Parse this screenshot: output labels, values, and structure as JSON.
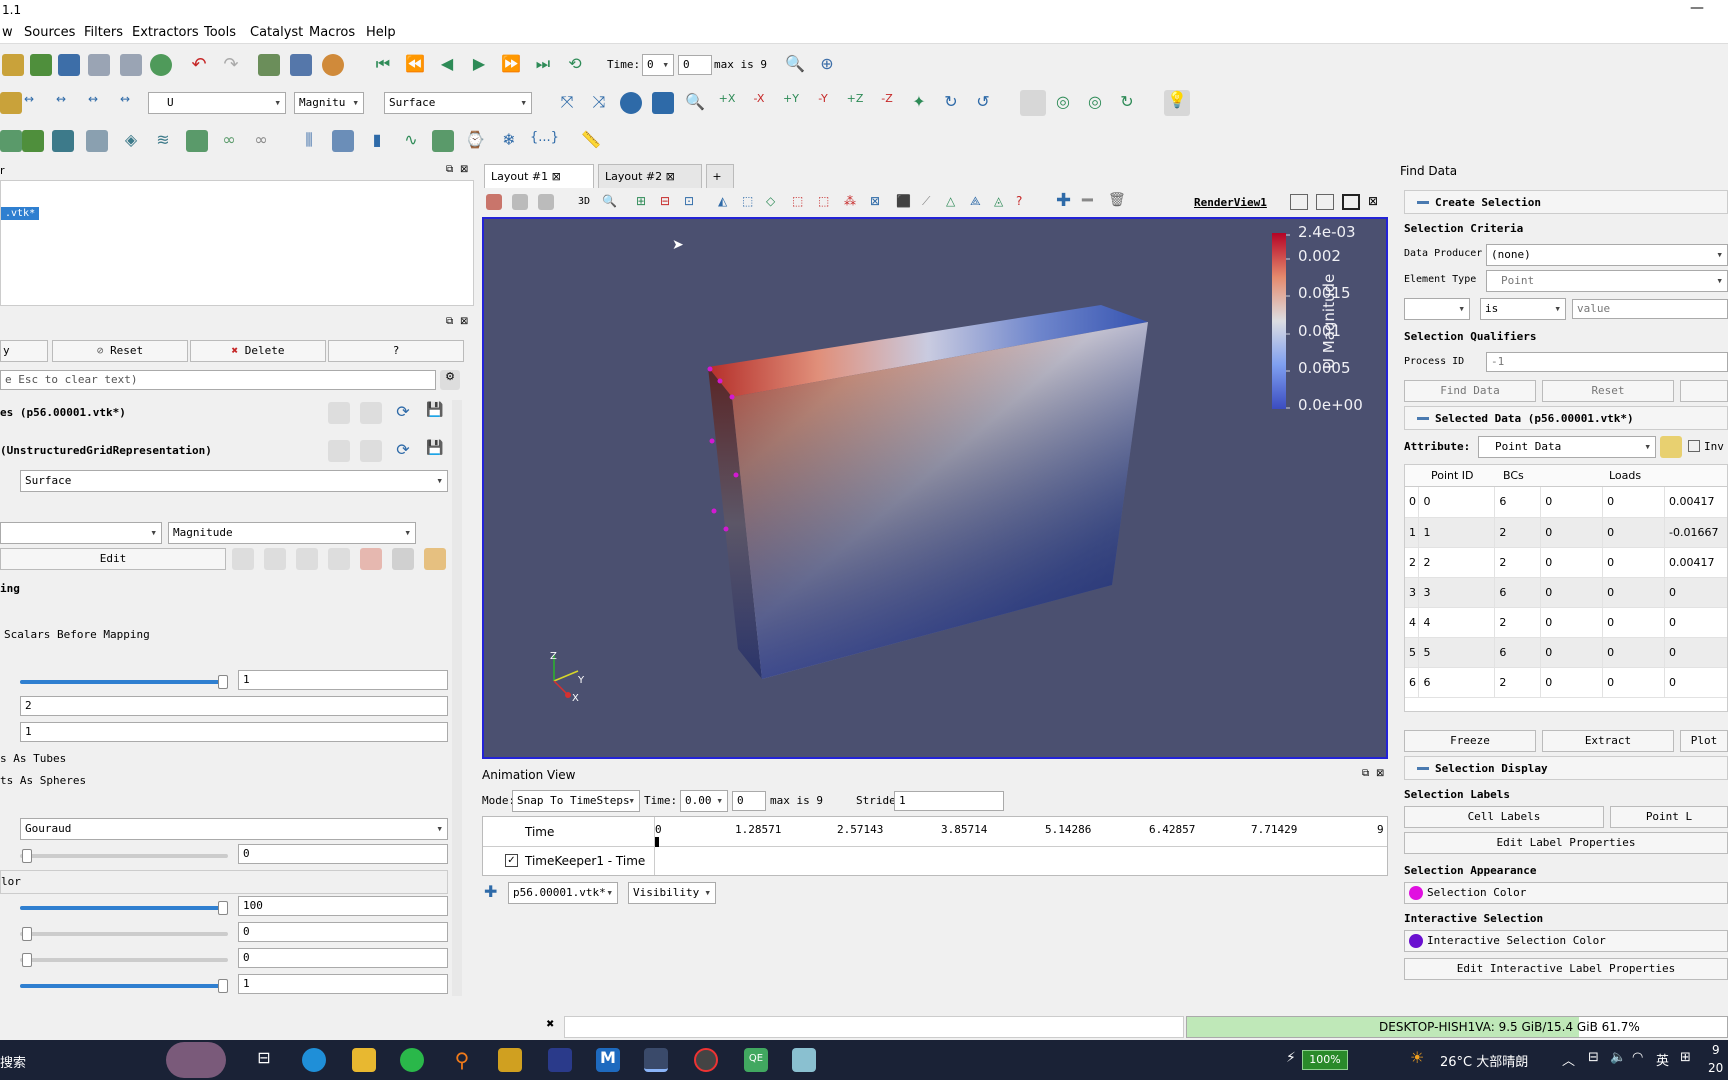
{
  "window": {
    "title": "1.1"
  },
  "menu": [
    "w",
    "Sources",
    "Filters",
    "Extractors",
    "Tools",
    "Catalyst",
    "Macros",
    "Help"
  ],
  "toolbar": {
    "time_label": "Time:",
    "time_value": "0",
    "time_index": "0",
    "max_label": "max is 9",
    "var_select": "U",
    "component_select": "Magnitu",
    "representation_select": "Surface"
  },
  "pipeline": {
    "item": ".vtk*",
    "header_label": "r"
  },
  "properties": {
    "apply_label": "y",
    "reset_label": "Reset",
    "delete_label": "Delete",
    "help_label": "?",
    "search_placeholder": "e Esc to clear text)",
    "section_props": "es (p56.00001.vtk*)",
    "section_display": "(UnstructuredGridRepresentation)",
    "representation": "Surface",
    "coloring_component": "Magnitude",
    "edit_label": "Edit",
    "scalar_coloring_label": "ing",
    "map_scalars_label": "Scalars Before Mapping",
    "slider1_value": "1",
    "field2_value": "2",
    "field3_value": "1",
    "tubes_label": "s As Tubes",
    "spheres_label": "ts As Spheres",
    "interpolation": "Gouraud",
    "slider_a_value": "0",
    "lor_label": "lor",
    "slider_b_value": "100",
    "slider_c_value": "0",
    "slider_d_value": "0",
    "slider_e_value": "1"
  },
  "layout_tabs": [
    {
      "label": "Layout #1"
    },
    {
      "label": "Layout #2"
    },
    {
      "label": "+"
    }
  ],
  "renderview": {
    "name": "RenderView1",
    "view_3d": "3D",
    "colorbar_title": "U Magnitude",
    "colorbar_ticks": [
      "2.4e-03",
      "0.002",
      "0.0015",
      "0.001",
      "0.0005",
      "0.0e+00"
    ],
    "axes": {
      "z": "Z",
      "y": "Y",
      "x": "X"
    }
  },
  "animation": {
    "title": "Animation View",
    "mode_label": "Mode:",
    "mode_value": "Snap To TimeSteps",
    "time_label": "Time:",
    "time_value": "0.00",
    "time_index": "0",
    "max_label": "max is 9",
    "stride_label": "Stride",
    "stride_value": "1",
    "time_col": "Time",
    "ticks": [
      "0",
      "1.28571",
      "2.57143",
      "3.85714",
      "5.14286",
      "6.42857",
      "7.71429",
      "9"
    ],
    "track": "TimeKeeper1 - Time",
    "source_select": "p56.00001.vtk*",
    "prop_select": "Visibility"
  },
  "find_data": {
    "title": "Find Data",
    "create_selection": "Create Selection",
    "selection_criteria": "Selection Criteria",
    "data_producer_label": "Data Producer",
    "data_producer_value": "(none)",
    "element_type_label": "Element Type",
    "element_type_value": "Point",
    "is_value": "is",
    "value_placeholder": "value",
    "selection_qualifiers": "Selection Qualifiers",
    "process_id_label": "Process ID",
    "process_id_value": "-1",
    "find_data_btn": "Find Data",
    "reset_btn": "Reset",
    "selected_data": "Selected Data (p56.00001.vtk*)",
    "attribute_label": "Attribute:",
    "attribute_value": "Point Data",
    "invert_label": "Inv",
    "columns": [
      "Point ID",
      "BCs",
      "Loads"
    ],
    "rows": [
      {
        "idx": "0",
        "id": "0",
        "bcs": "6",
        "a": "0",
        "b": "0",
        "load": "0.00417"
      },
      {
        "idx": "1",
        "id": "1",
        "bcs": "2",
        "a": "0",
        "b": "0",
        "load": "-0.01667"
      },
      {
        "idx": "2",
        "id": "2",
        "bcs": "2",
        "a": "0",
        "b": "0",
        "load": "0.00417"
      },
      {
        "idx": "3",
        "id": "3",
        "bcs": "6",
        "a": "0",
        "b": "0",
        "load": "0"
      },
      {
        "idx": "4",
        "id": "4",
        "bcs": "2",
        "a": "0",
        "b": "0",
        "load": "0"
      },
      {
        "idx": "5",
        "id": "5",
        "bcs": "6",
        "a": "0",
        "b": "0",
        "load": "0"
      },
      {
        "idx": "6",
        "id": "6",
        "bcs": "2",
        "a": "0",
        "b": "0",
        "load": "0"
      }
    ],
    "freeze_btn": "Freeze",
    "extract_btn": "Extract",
    "plot_btn": "Plot",
    "selection_display": "Selection Display",
    "selection_labels": "Selection Labels",
    "cell_labels_btn": "Cell Labels",
    "point_labels_btn": "Point L",
    "edit_label_props": "Edit Label Properties",
    "selection_appearance": "Selection Appearance",
    "selection_color": "Selection Color",
    "interactive_selection": "Interactive Selection",
    "interactive_selection_color": "Interactive Selection Color",
    "edit_interactive_label_props": "Edit Interactive Label Properties"
  },
  "status": {
    "memory": "DESKTOP-HISH1VA: 9.5 GiB/15.4 GiB 61.7%"
  },
  "taskbar": {
    "search_text": "搜索",
    "battery": "100%",
    "weather": "26°C 大部晴朗",
    "ime": "英",
    "time": "9",
    "date": "20"
  },
  "colors": {
    "accent": "#2323d6",
    "viewport_bg": "#4b5070",
    "memory_bar": "#bfe8b8"
  }
}
